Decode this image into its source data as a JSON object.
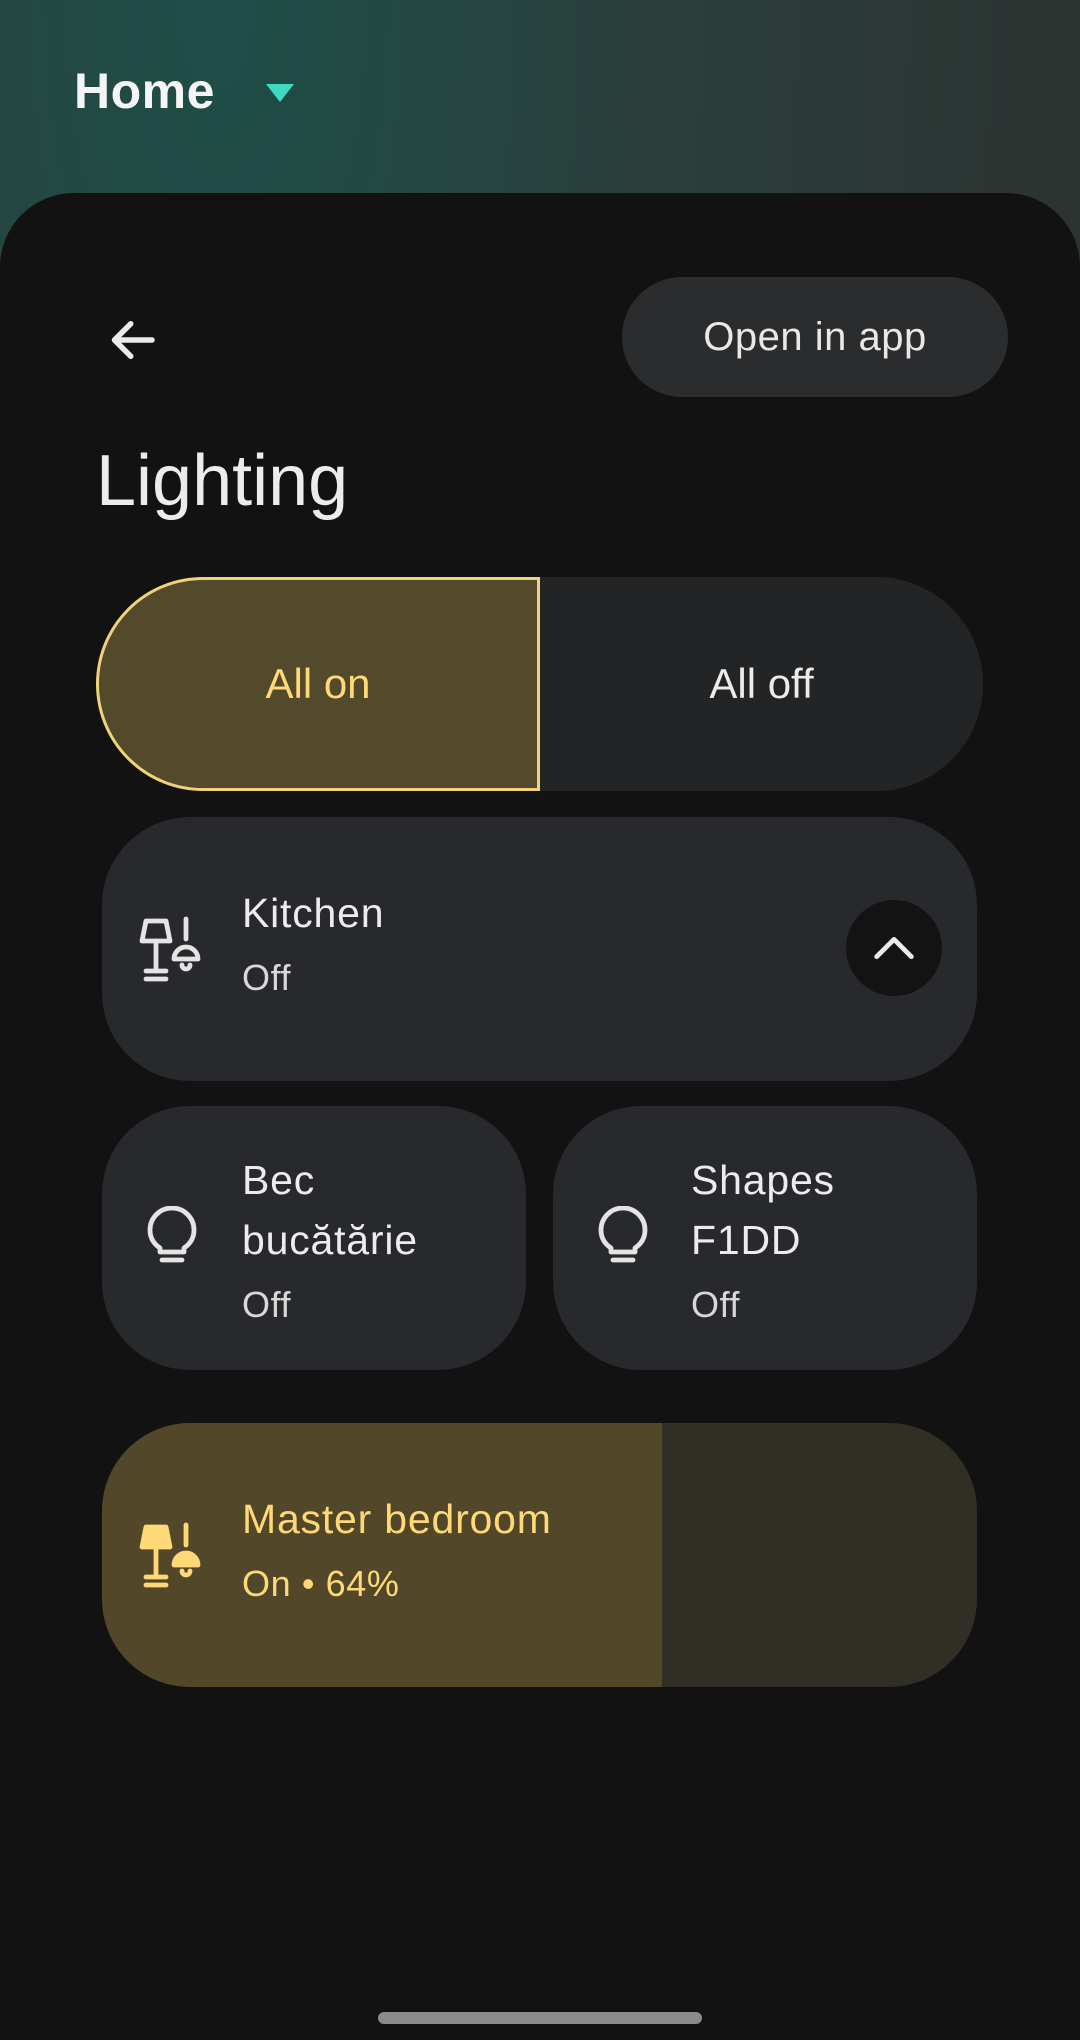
{
  "header": {
    "home_label": "Home"
  },
  "toolbar": {
    "open_in_app_label": "Open in app"
  },
  "page": {
    "title": "Lighting"
  },
  "segmented": {
    "all_on_label": "All on",
    "all_off_label": "All off"
  },
  "devices": {
    "kitchen": {
      "name": "Kitchen",
      "status": "Off",
      "icon": "lamp-group-icon"
    },
    "bec": {
      "name_line1": "Bec",
      "name_line2": "bucătărie",
      "status": "Off",
      "icon": "lightbulb-icon"
    },
    "shapes": {
      "name_line1": "Shapes",
      "name_line2": "F1DD",
      "status": "Off",
      "icon": "lightbulb-icon"
    },
    "master": {
      "name": "Master bedroom",
      "status": "On • 64%",
      "brightness_percent": 64,
      "icon": "lamp-group-icon"
    }
  },
  "colors": {
    "accent_on": "#ffd978",
    "accent_on_bg": "#534a2c",
    "teal_caret": "#3fd9c3",
    "sheet_bg": "#121212",
    "card_bg": "#28292c"
  }
}
